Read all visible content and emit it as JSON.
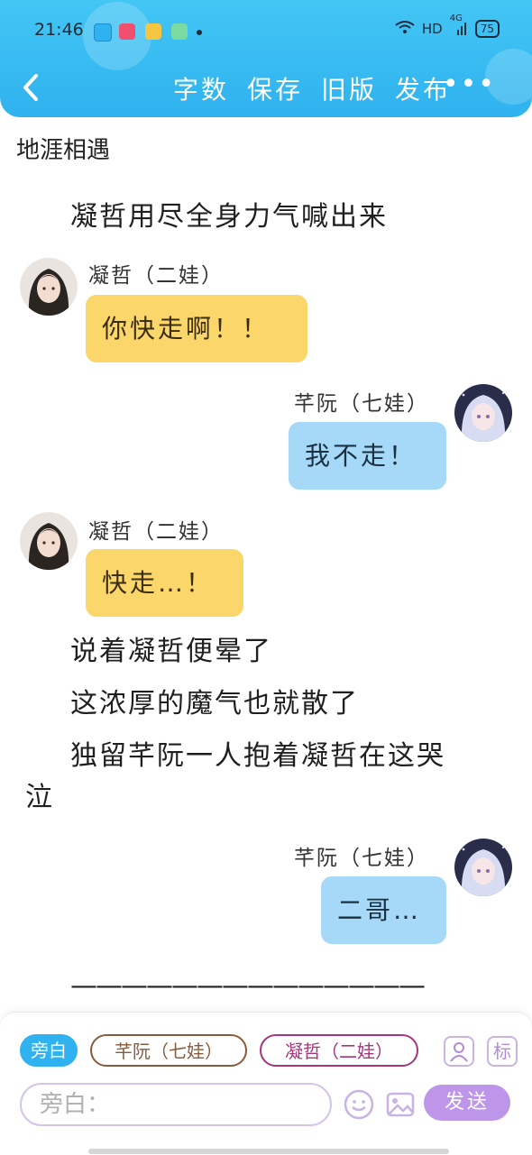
{
  "status_bar": {
    "time": "21:46",
    "network": "HD",
    "cell": "4G",
    "battery": "75"
  },
  "nav": {
    "back_icon": "chevron-left-icon",
    "actions": [
      "字数",
      "保存",
      "旧版",
      "发布"
    ],
    "more_label": "•••"
  },
  "story": {
    "title": "地涯相遇",
    "narration_1": "凝哲用尽全身力气喊出来",
    "message_1": {
      "speaker": "凝哲（二娃）",
      "text": "你快走啊！！"
    },
    "message_2": {
      "speaker": "芊阮（七娃）",
      "text": "我不走！"
    },
    "message_3": {
      "speaker": "凝哲（二娃）",
      "text": "快走…！"
    },
    "narration_2": "说着凝哲便晕了",
    "narration_3": "这浓厚的魔气也就散了",
    "narration_4": "独留芊阮一人抱着凝哲在这哭泣",
    "message_4": {
      "speaker": "芊阮（七娃）",
      "text": "二哥…"
    },
    "divider": "——————————————"
  },
  "input_panel": {
    "role_chips": [
      "旁白",
      "芊阮（七娃）",
      "凝哲（二娃）"
    ],
    "character_button": "头像",
    "tag_button": "标",
    "input_placeholder": "旁白：",
    "send_label": "发送"
  },
  "colors": {
    "header": "#2fb2ef",
    "left_bubble": "#fbd66a",
    "right_bubble": "#a6d9f7",
    "send_button": "#bd96ea"
  }
}
